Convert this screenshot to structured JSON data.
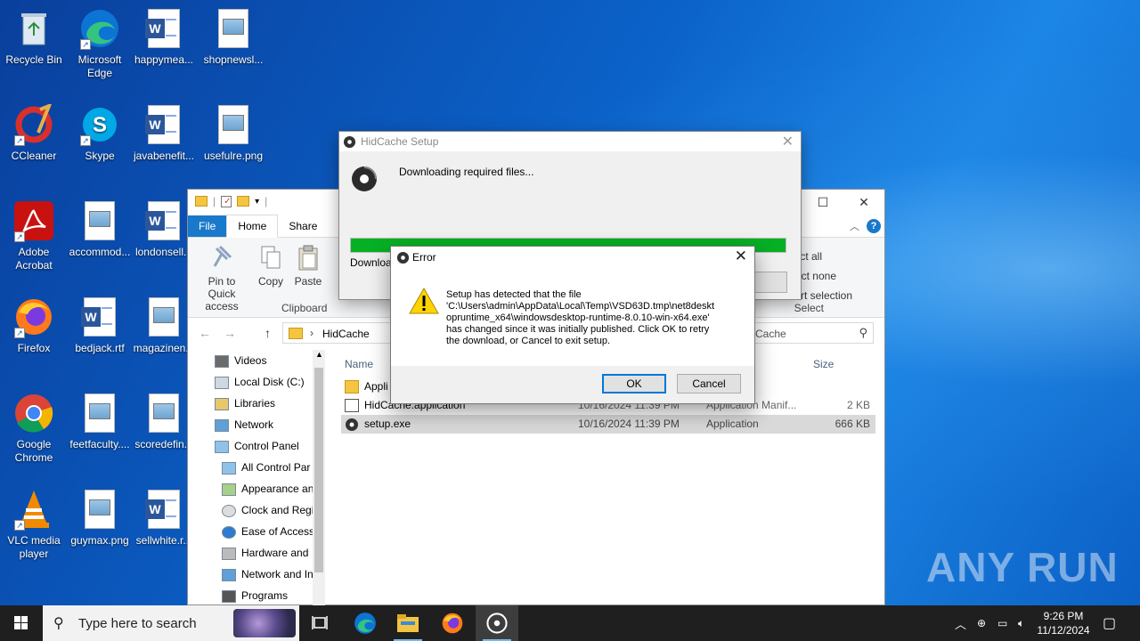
{
  "desktop": {
    "icons": [
      {
        "label": "Recycle Bin"
      },
      {
        "label": "Microsoft Edge"
      },
      {
        "label": "happymea..."
      },
      {
        "label": "shopnewsl..."
      },
      {
        "label": "CCleaner"
      },
      {
        "label": "Skype"
      },
      {
        "label": "javabenefit..."
      },
      {
        "label": "usefulre.png"
      },
      {
        "label": "Adobe Acrobat"
      },
      {
        "label": "accommod..."
      },
      {
        "label": "londonsell..."
      },
      {
        "label": "Firefox"
      },
      {
        "label": "bedjack.rtf"
      },
      {
        "label": "magazinen..."
      },
      {
        "label": "Google Chrome"
      },
      {
        "label": "feetfaculty...."
      },
      {
        "label": "scoredefin..."
      },
      {
        "label": "VLC media player"
      },
      {
        "label": "guymax.png"
      },
      {
        "label": "sellwhite.r..."
      }
    ]
  },
  "explorer": {
    "tabs": {
      "file": "File",
      "home": "Home",
      "share": "Share"
    },
    "ribbon": {
      "pin": "Pin to Quick access",
      "copy": "Copy",
      "paste": "Paste",
      "clipboard": "Clipboard",
      "select_all": "ct all",
      "select_none": "ct none",
      "invert": "rt selection",
      "select": "Select"
    },
    "address": "HidCache",
    "search": "Cache",
    "nav": [
      "Videos",
      "Local Disk (C:)",
      "Libraries",
      "Network",
      "Control Panel",
      "All Control Par",
      "Appearance an",
      "Clock and Regi",
      "Ease of Access",
      "Hardware and",
      "Network and In",
      "Programs"
    ],
    "columns": {
      "name": "Name",
      "size": "Size"
    },
    "files": [
      {
        "name": "Appli",
        "date": "",
        "type": "",
        "size": ""
      },
      {
        "name": "HidCache.application",
        "date": "10/16/2024 11:39 PM",
        "type": "Application Manif...",
        "size": "2 KB"
      },
      {
        "name": "setup.exe",
        "date": "10/16/2024 11:39 PM",
        "type": "Application",
        "size": "666 KB"
      }
    ]
  },
  "setup": {
    "title": "HidCache Setup",
    "status": "Downloading required files...",
    "progress": 1.0,
    "download_label": "Download"
  },
  "error": {
    "title": "Error",
    "message": "Setup has detected that the file\n'C:\\Users\\admin\\AppData\\Local\\Temp\\VSD63D.tmp\\net8deskt\nopruntime_x64\\windowsdesktop-runtime-8.0.10-win-x64.exe'\nhas changed since it was initially published. Click OK to retry\nthe download, or Cancel to exit setup.",
    "ok": "OK",
    "cancel": "Cancel"
  },
  "taskbar": {
    "search_placeholder": "Type here to search",
    "time": "9:26 PM",
    "date": "11/12/2024"
  },
  "watermark": "ANY RUN",
  "colors": {
    "progress": "#06b025",
    "accent": "#0078d7",
    "file_tab": "#1979ca"
  }
}
